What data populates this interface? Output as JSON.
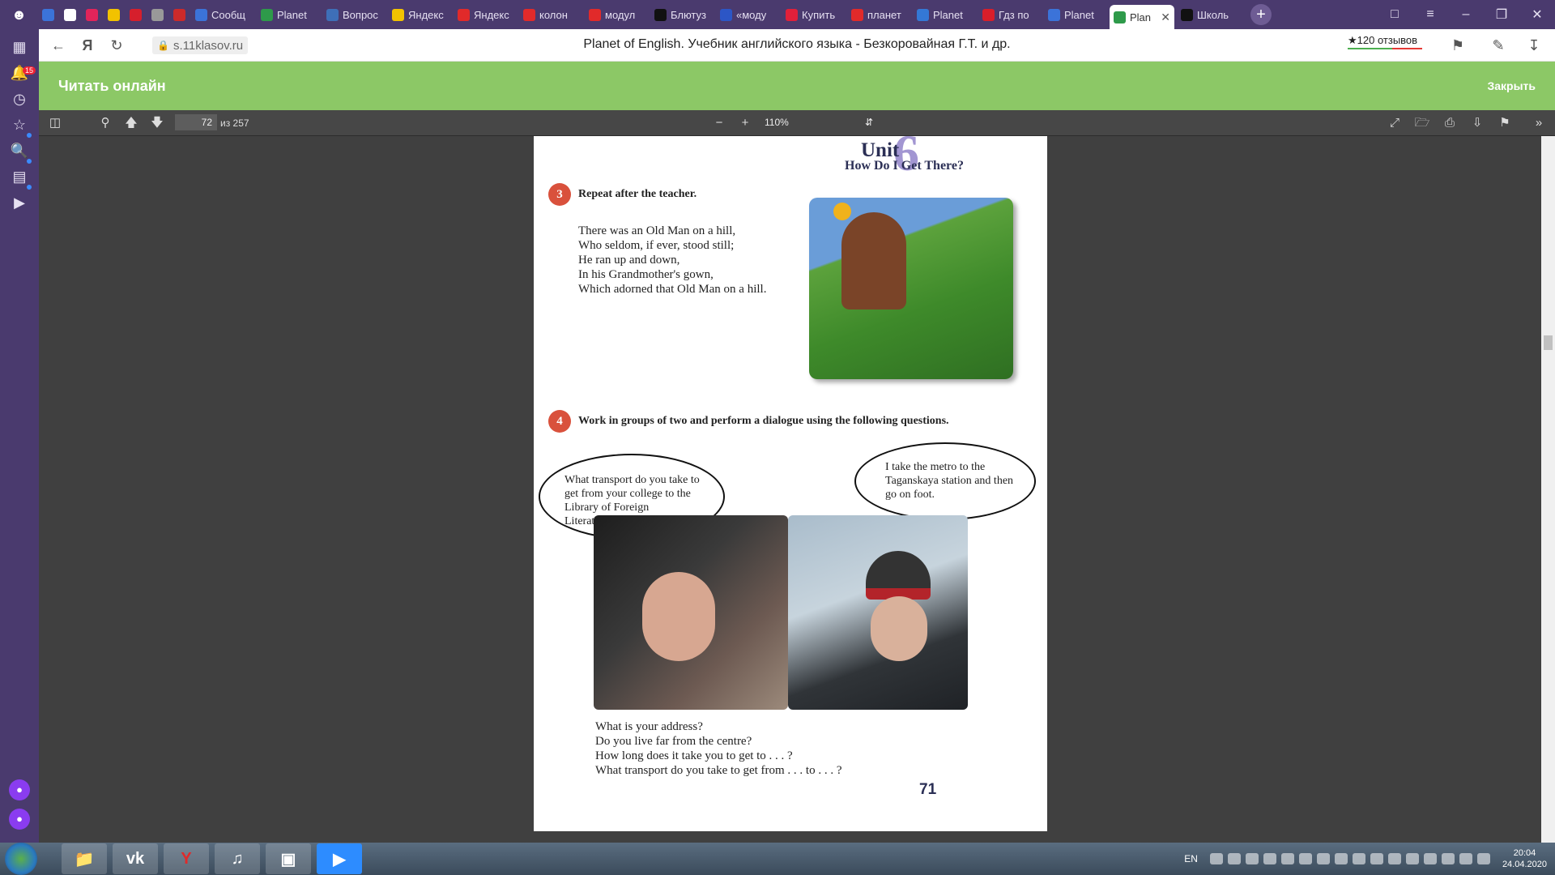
{
  "browser": {
    "tabs": [
      {
        "label": "",
        "fav": "#3b73d9",
        "icon": "chat-icon"
      },
      {
        "label": "",
        "fav": "#ffffff",
        "icon": "google-icon"
      },
      {
        "label": "",
        "fav": "#e2245a",
        "icon": "ivi-icon"
      },
      {
        "label": "",
        "fav": "#f2c200",
        "icon": "yandex-zen-icon"
      },
      {
        "label": "",
        "fav": "#d61f2c",
        "icon": "umbrella-icon"
      },
      {
        "label": "",
        "fav": "#999999",
        "icon": "apple-icon"
      },
      {
        "label": "",
        "fav": "#cc2a2a",
        "icon": "calendar-icon"
      },
      {
        "label": "Сообщ",
        "fav": "#3b73d9"
      },
      {
        "label": "Planet",
        "fav": "#2e9a4a"
      },
      {
        "label": "Вопрос",
        "fav": "#3e6fb8"
      },
      {
        "label": "Яндекс",
        "fav": "#f2c200"
      },
      {
        "label": "Яндекс",
        "fav": "#e12a2a"
      },
      {
        "label": "колон",
        "fav": "#e12a2a"
      },
      {
        "label": "модул",
        "fav": "#e12a2a"
      },
      {
        "label": "Блютуз",
        "fav": "#111111"
      },
      {
        "label": "«моду",
        "fav": "#2c56c6"
      },
      {
        "label": "Купить",
        "fav": "#e0203a"
      },
      {
        "label": "планет",
        "fav": "#e12a2a"
      },
      {
        "label": "Planet",
        "fav": "#3478d6"
      },
      {
        "label": "Гдз по",
        "fav": "#d81e2a"
      },
      {
        "label": "Planet",
        "fav": "#3b73d9"
      },
      {
        "label": "Plan",
        "fav": "#2e9a4a",
        "active": true
      },
      {
        "label": "Школь",
        "fav": "#111111"
      }
    ],
    "url": "s.11klasov.ru",
    "page_title": "Planet of English. Учебник английского языка - Безкоровайная Г.Т. и др.",
    "reviews_label": "★120 отзывов",
    "sidebar_badge": "15"
  },
  "reader": {
    "title": "Читать онлайн",
    "close_label": "Закрыть"
  },
  "pdf": {
    "page_current": "72",
    "page_total": "из 257",
    "zoom": "110%"
  },
  "textbook": {
    "unit": "Unit",
    "unit_number": "6",
    "unit_title": "How Do I Get There?",
    "task3_num": "3",
    "task3_title": "Repeat after the teacher.",
    "poem": [
      "There was an Old Man on a hill,",
      "Who seldom, if ever, stood still;",
      "He ran up and down,",
      "In his Grandmother's gown,",
      "Which adorned that Old Man on a hill."
    ],
    "task4_num": "4",
    "task4_title": "Work in groups of two and perform a dialogue using the following questions.",
    "bubble_left": "What transport do you take to get from your college to the Library of Foreign Literature?",
    "bubble_right": "I take the metro to the Taganskaya station and then go on foot.",
    "questions": [
      "What is your address?",
      "Do you live far from the centre?",
      "How long does it take you to get to . . . ?",
      "What transport do you take to get from . . . to . . . ?"
    ],
    "page_number": "71"
  },
  "taskbar": {
    "lang": "EN",
    "time": "20:04",
    "date": "24.04.2020"
  }
}
